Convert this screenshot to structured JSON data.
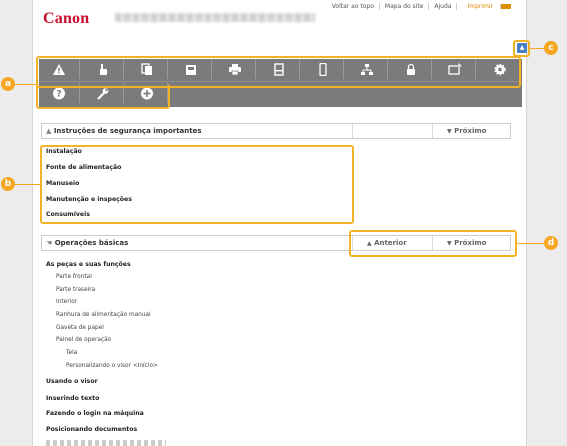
{
  "header": {
    "logo": "Canon",
    "links": [
      "Voltar ao topo",
      "Mapa do site",
      "Ajuda",
      "Imprimir"
    ]
  },
  "toolbar": {
    "row1_icons": [
      "warning-icon",
      "hand-pointer-icon",
      "copy-icon",
      "fax-icon",
      "printer-icon",
      "scanner-icon",
      "mobile-icon",
      "network-icon",
      "lock-icon",
      "remote-ui-icon",
      "gear-icon"
    ],
    "row2_icons": [
      "help-icon",
      "wrench-icon",
      "plus-icon"
    ],
    "row2_glyphs": [
      "?",
      "✎",
      "+"
    ]
  },
  "top_button": {
    "glyph": "▲"
  },
  "section1": {
    "title": "Instruções de segurança importantes",
    "next": "Próximo",
    "items": [
      "Instalação",
      "Fonte de alimentação",
      "Manuseio",
      "Manutenção e inspeções",
      "Consumíveis"
    ]
  },
  "section2": {
    "title": "Operações básicas",
    "prev": "Anterior",
    "next": "Próximo",
    "items": [
      {
        "label": "As peças e suas funções",
        "level": 0
      },
      {
        "label": "Parte frontal",
        "level": 1
      },
      {
        "label": "Parte traseira",
        "level": 1
      },
      {
        "label": "Interior",
        "level": 1
      },
      {
        "label": "Ranhura de alimentação manual",
        "level": 1
      },
      {
        "label": "Gaveta de papel",
        "level": 1
      },
      {
        "label": "Painel de operação",
        "level": 1
      },
      {
        "label": "Tela",
        "level": 2
      },
      {
        "label": "Personalizando o visor <Início>",
        "level": 2
      },
      {
        "label": "Usando o visor",
        "level": 0
      },
      {
        "label": "Inserindo texto",
        "level": 0
      },
      {
        "label": "Fazendo o login na máquina",
        "level": 0
      },
      {
        "label": "Posicionando documentos",
        "level": 0
      }
    ]
  },
  "callouts": {
    "a": "a",
    "b": "b",
    "c": "c",
    "d": "d"
  },
  "colors": {
    "accent": "#f5a623",
    "brand": "#c8102e",
    "toolbar": "#7b7b7b"
  }
}
